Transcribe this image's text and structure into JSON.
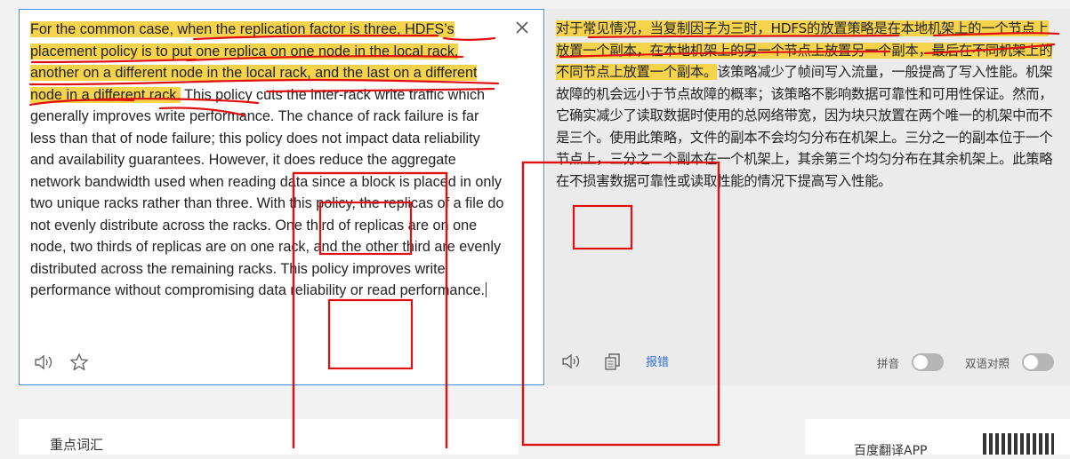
{
  "source": {
    "highlighted_text": "For the common case, when the replication factor is three, HDFS’s placement policy is to put one replica on one node in the local rack, another on a different node in the local rack, and the last on a different node in a different rack.",
    "rest_text": " This policy cuts the inter-rack write traffic which generally improves write performance. The chance of rack failure is far less than that of node failure; this policy does not impact data reliability and availability guarantees. However, it does reduce the aggregate network bandwidth used when reading data since a block is placed in only two unique racks rather than three. With this policy, the replicas of a file do not evenly distribute across the racks. One third of replicas are on one node, two thirds of replicas are on one rack, and the other third are evenly distributed across the remaining racks. This policy improves write performance without compromising data reliability or read performance."
  },
  "target": {
    "highlighted_text": "对于常见情况，当复制因子为三时，HDFS的放置策略是在本地机架上的一个节点上放置一个副本，在本地机架上的另一个节点上放置另一个副本，最后在不同机架上的不同节点上放置一个副本。",
    "rest_text": "该策略减少了帧间写入流量，一般提高了写入性能。机架故障的机会远小于节点故障的概率；该策略不影响数据可靠性和可用性保证。然而，它确实减少了读取数据时使用的总网络带宽，因为块只放置在两个唯一的机架中而不是三个。使用此策略，文件的副本不会均匀分布在机架上。三分之一的副本位于一个节点上，三分之二个副本在一个机架上，其余第三个均匀分布在其余机架上。此策略在不损害数据可靠性或读取性能的情况下提高写入性能。"
  },
  "toolbar": {
    "close_icon": "close-icon",
    "left_icons": [
      "speaker-icon",
      "star-icon"
    ],
    "right_icons": [
      "speaker-icon",
      "copy-icon"
    ],
    "report_label": "报错",
    "pinyin_label": "拼音",
    "bilingual_label": "双语对照"
  },
  "bottom": {
    "vocab_title": "重点词汇",
    "app_title": "百度翻译APP"
  },
  "colors": {
    "highlight": "#f5d34a",
    "annotation_red": "#e01010",
    "accent_blue": "#4a90e2",
    "link_blue": "#2b6fd6"
  }
}
